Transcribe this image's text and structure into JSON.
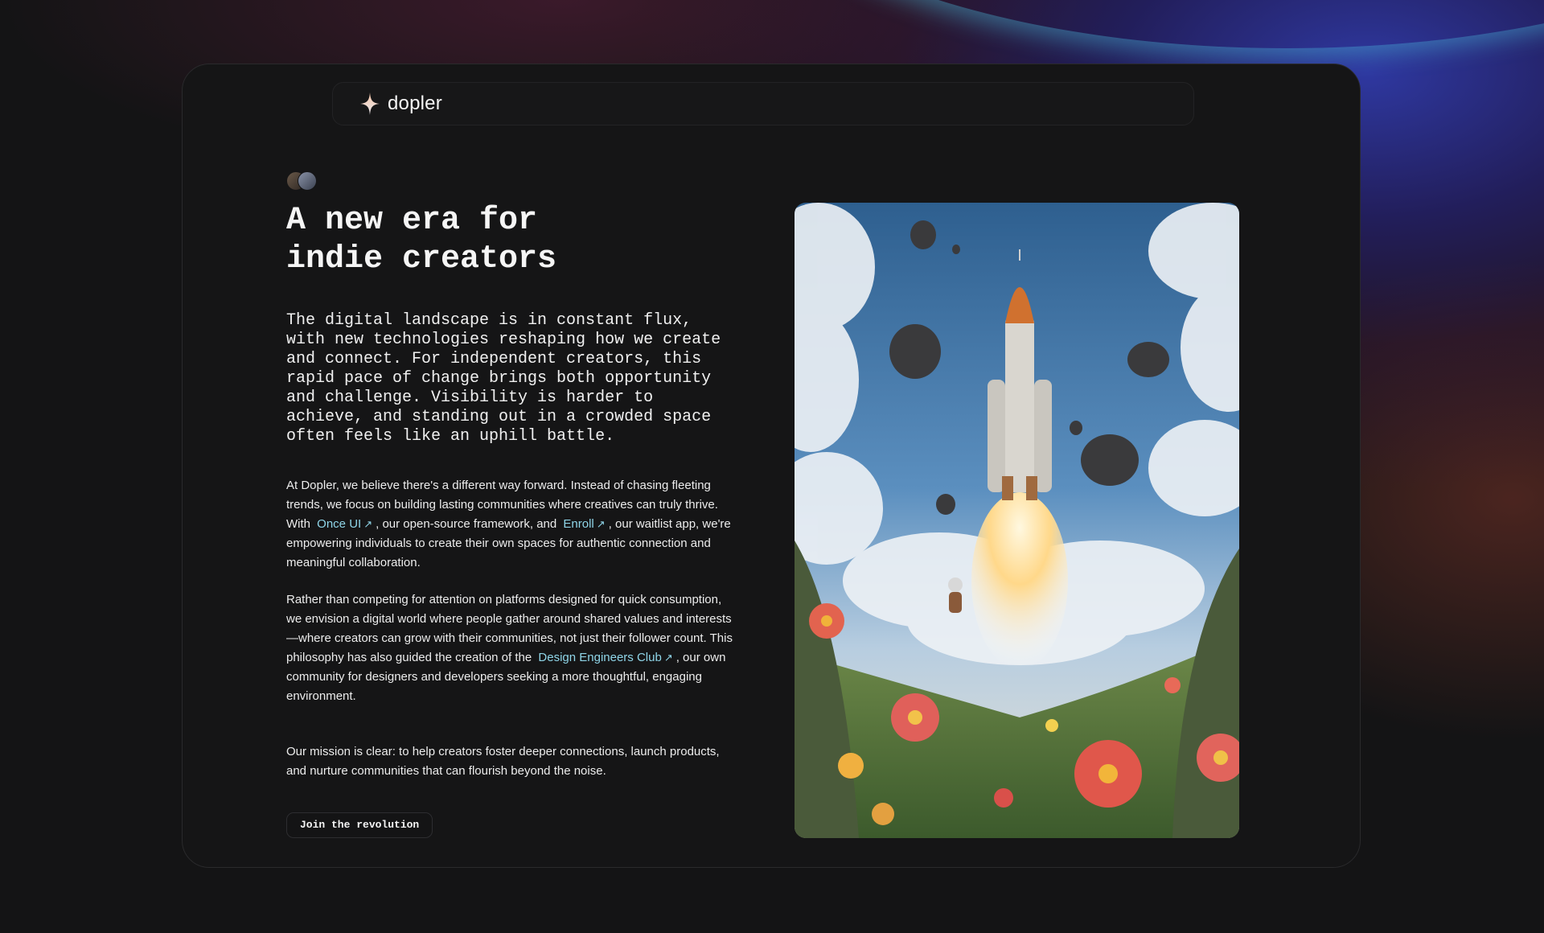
{
  "brand": {
    "name": "dopler"
  },
  "hero": {
    "headline": "A new era for\nindie creators",
    "lead": "The digital landscape is in constant flux, with new technologies reshaping how we create and connect. For independent creators, this rapid pace of change brings both opportunity and challenge. Visibility is harder to achieve, and standing out in a crowded space often feels like an uphill battle.",
    "p1": {
      "before": "At Dopler, we believe there's a different way forward. Instead of chasing fleeting trends, we focus on building lasting communities where creatives can truly thrive. With",
      "link1": "Once UI",
      "middle": ", our open-source framework, and",
      "link2": "Enroll",
      "after": ", our waitlist app, we're empowering individuals to create their own spaces for authentic connection and meaningful collaboration."
    },
    "p2": {
      "before": "Rather than competing for attention on platforms designed for quick consumption, we envision a digital world where people gather around shared values and interests—where creators can grow with their communities, not just their follower count. This philosophy has also guided the creation of the",
      "link": "Design Engineers Club",
      "after": ", our own community for designers and developers seeking a more thoughtful, engaging environment."
    },
    "p3": "Our mission is clear: to help creators foster deeper connections, launch products, and nurture communities that can flourish beyond the noise.",
    "cta_label": "Join the revolution"
  },
  "icons": {
    "logo": "sparkle-icon",
    "external_link": "arrow-up-right-icon"
  },
  "colors": {
    "background": "#141415",
    "card": "#151516",
    "link": "#8fd5e8",
    "text": "#f2f2f2"
  }
}
